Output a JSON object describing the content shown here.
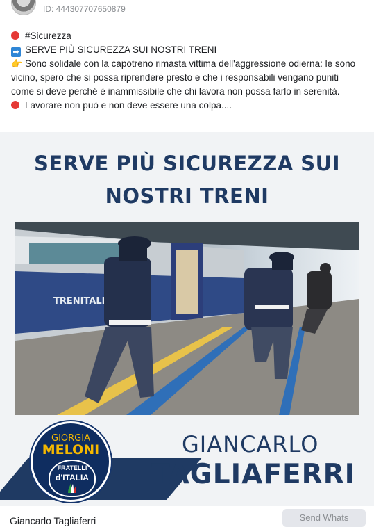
{
  "post": {
    "id_label": "ID: 444307707650879",
    "lines": {
      "hashtag": "#Sicurezza",
      "headline": "SERVE PIÙ SICUREZZA SUI NOSTRI TRENI",
      "body": "Sono solidale con la capotreno rimasta vittima dell'aggressione odierna: le sono vicino, spero che si possa riprendere presto e che i responsabili vengano puniti come si deve perché è inammissibile che chi lavora non possa farlo in serenità.",
      "closing": "Lavorare non può e non deve essere una colpa...."
    },
    "icons": {
      "hashtag": "red-circle-icon",
      "headline": "right-arrow-icon",
      "body": "pointing-hand-icon",
      "closing": "red-circle-icon"
    }
  },
  "poster": {
    "title_line1": "SERVE PIÙ SICUREZZA SUI",
    "title_line2": "NOSTRI  TRENI",
    "photo_train_label": "TRENITALIA",
    "logo": {
      "top": "GIORGIA",
      "name": "MELONI",
      "party_line1": "FRATELLI",
      "party_line2": "d'ITALIA"
    },
    "candidate_first": "GIANCARLO",
    "candidate_last": "TAGLIAFERRI"
  },
  "footer": {
    "author": "Giancarlo Tagliaferri",
    "send_button": "Send Whats"
  },
  "colors": {
    "poster_navy": "#1f3a63",
    "accent_yellow": "#f5b800",
    "red_dot": "#e53935",
    "arrow_blue": "#2f86d6"
  }
}
